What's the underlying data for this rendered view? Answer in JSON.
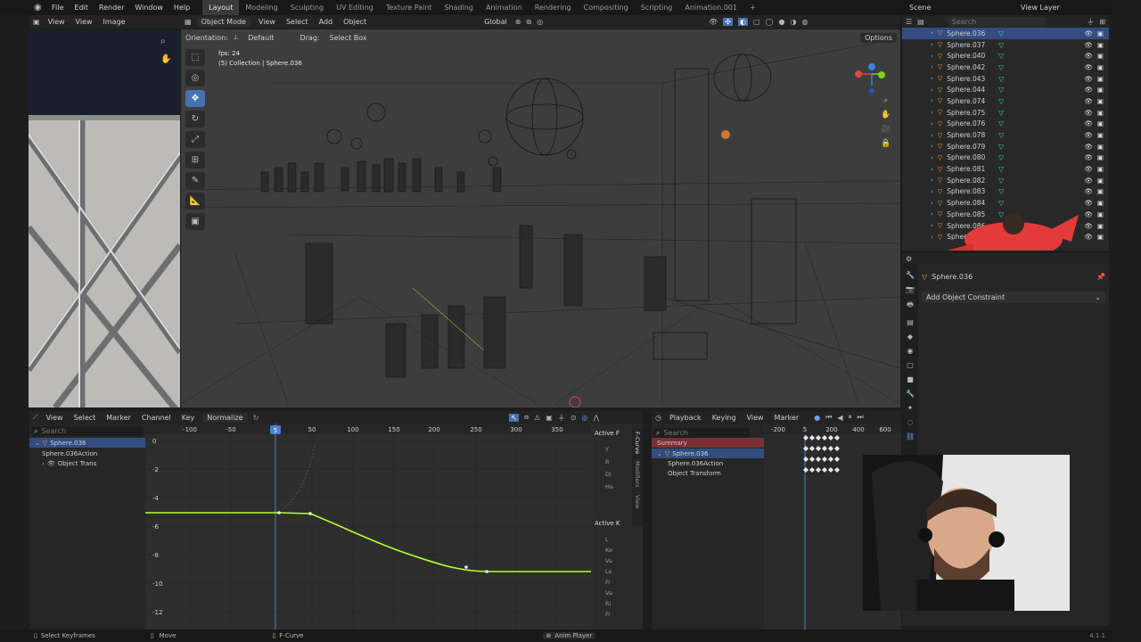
{
  "topbar": {
    "menus": [
      "File",
      "Edit",
      "Render",
      "Window",
      "Help"
    ],
    "workspaces": [
      "Layout",
      "Modeling",
      "Sculpting",
      "UV Editing",
      "Texture Paint",
      "Shading",
      "Animation",
      "Rendering",
      "Compositing",
      "Scripting",
      "Animation.001"
    ],
    "scene_label": "Scene",
    "viewlayer_label": "View Layer"
  },
  "image_editor": {
    "menus": [
      "View",
      "View",
      "Image"
    ]
  },
  "viewport": {
    "mode": "Object Mode",
    "menus": [
      "View",
      "Select",
      "Add",
      "Object"
    ],
    "transform_orientation": "Global",
    "orientation_label": "Orientation:",
    "orientation_value": "Default",
    "drag_label": "Drag:",
    "drag_value": "Select Box",
    "options_label": "Options",
    "fps": "fps: 24",
    "collection_text": "(5) Collection | Sphere.036"
  },
  "outliner": {
    "search_placeholder": "Search",
    "items": [
      "Sphere.036",
      "Sphere.037",
      "Sphere.040",
      "Sphere.042",
      "Sphere.043",
      "Sphere.044",
      "Sphere.074",
      "Sphere.075",
      "Sphere.076",
      "Sphere.078",
      "Sphere.079",
      "Sphere.080",
      "Sphere.081",
      "Sphere.082",
      "Sphere.083",
      "Sphere.084",
      "Sphere.085",
      "Sphere.086",
      "Sphere.087"
    ]
  },
  "properties": {
    "object_name": "Sphere.036",
    "add_constraint": "Add Object Constraint"
  },
  "graph_editor": {
    "menus": [
      "View",
      "Select",
      "Marker",
      "Channel",
      "Key"
    ],
    "normalize_label": "Normalize",
    "search_placeholder": "Search",
    "channels": [
      "Sphere.036",
      "Sphere.036Action",
      "Object Trans"
    ],
    "x_ticks": [
      "-100",
      "-50",
      "5",
      "50",
      "100",
      "150",
      "200",
      "250",
      "300",
      "350"
    ],
    "y_ticks": [
      "0",
      "-2",
      "-4",
      "-6",
      "-8",
      "-10",
      "-12"
    ],
    "sidebar_panels": [
      "Active F",
      "Active K"
    ],
    "sidebar_tabs": [
      "F-Curve",
      "Modifiers",
      "View"
    ],
    "sidebar_fields": [
      "Y",
      "R",
      "Di",
      "Ha",
      "L",
      "Ke",
      "Va",
      "Le",
      "Fr",
      "Va",
      "Ri",
      "Fr"
    ]
  },
  "dopesheet": {
    "menus": [
      "Playback",
      "Keying",
      "View",
      "Marker"
    ],
    "search_placeholder": "Search",
    "channels": [
      "Summary",
      "Sphere.036",
      "Sphere.036Action",
      "Object Transform"
    ],
    "x_ticks": [
      "-200",
      "5",
      "200",
      "400",
      "600"
    ]
  },
  "status": {
    "select": "Select Keyframes",
    "move": "Move",
    "fcurve": "F-Curve",
    "anim_player": "Anim Player",
    "version": "4.1.1"
  },
  "colors": {
    "accent": "#4772b3",
    "curve": "#b4ff2a",
    "outliner_sel": "#334d80",
    "dopesheet_summary": "#7a2f33"
  }
}
